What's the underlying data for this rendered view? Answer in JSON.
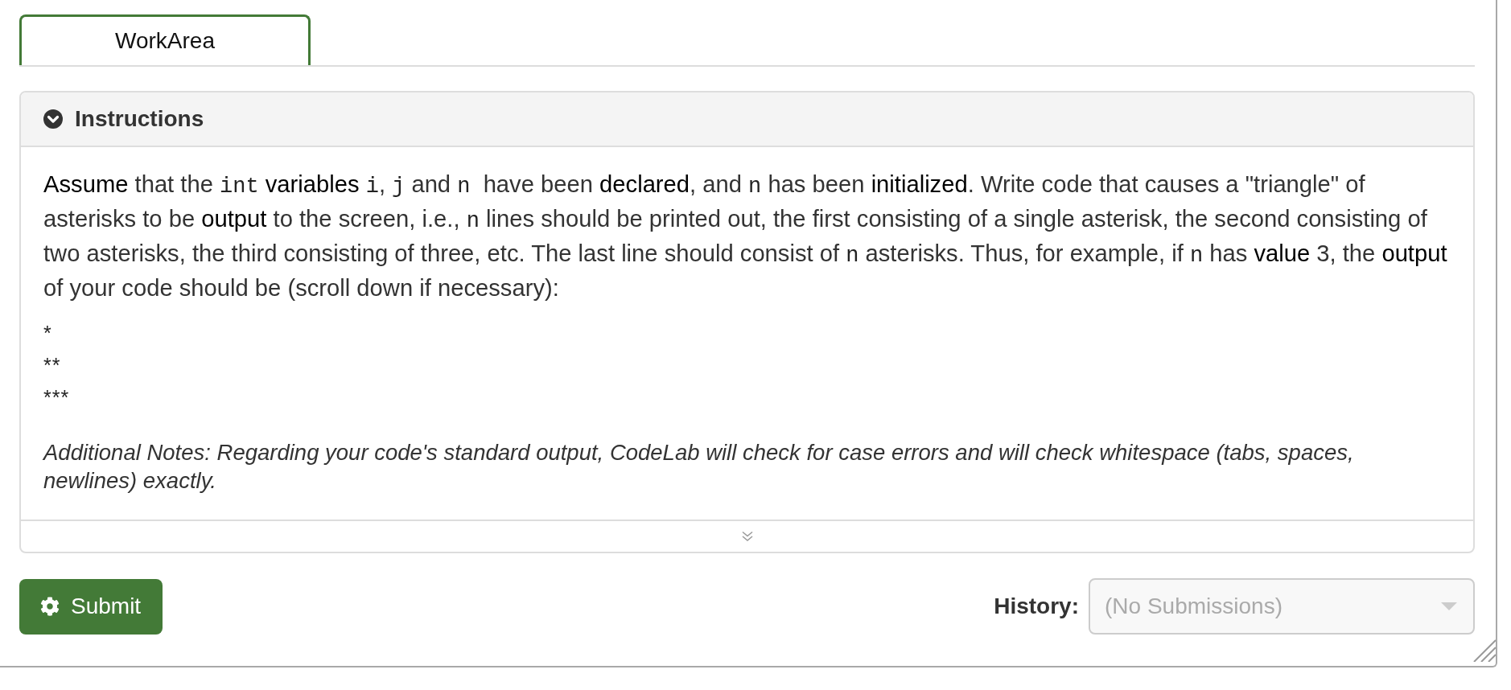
{
  "tabs": [
    {
      "label": "WorkArea",
      "selected": true
    }
  ],
  "instructions": {
    "title": "Instructions",
    "expanded": true,
    "paragraph": [
      {
        "kind": "term",
        "text": "Assume"
      },
      {
        "kind": "text",
        "text": " that the "
      },
      {
        "kind": "code",
        "text": "int"
      },
      {
        "kind": "term",
        "text": " variables "
      },
      {
        "kind": "code",
        "text": "i"
      },
      {
        "kind": "text",
        "text": ", "
      },
      {
        "kind": "code",
        "text": "j"
      },
      {
        "kind": "text",
        "text": " and "
      },
      {
        "kind": "code",
        "text": "n"
      },
      {
        "kind": "text",
        "text": "  have been "
      },
      {
        "kind": "term",
        "text": "declared"
      },
      {
        "kind": "text",
        "text": ", and "
      },
      {
        "kind": "code",
        "text": "n"
      },
      {
        "kind": "text",
        "text": " has been "
      },
      {
        "kind": "term",
        "text": "initialized"
      },
      {
        "kind": "text",
        "text": ". Write code that causes a \"triangle\" of asterisks to be "
      },
      {
        "kind": "term",
        "text": "output"
      },
      {
        "kind": "text",
        "text": " to the screen, i.e., "
      },
      {
        "kind": "code",
        "text": "n"
      },
      {
        "kind": "text",
        "text": " lines should be printed out, the first consisting of a single asterisk, the second consisting of two asterisks, the third consisting of three, etc. The last line should consist of "
      },
      {
        "kind": "code",
        "text": "n"
      },
      {
        "kind": "text",
        "text": " asterisks. Thus, for example, if "
      },
      {
        "kind": "code",
        "text": "n"
      },
      {
        "kind": "text",
        "text": " has "
      },
      {
        "kind": "term",
        "text": "value"
      },
      {
        "kind": "text",
        "text": " 3, the "
      },
      {
        "kind": "term",
        "text": "output"
      },
      {
        "kind": "text",
        "text": " of your code should be (scroll down if necessary):"
      }
    ],
    "example_output": "*\n**\n***",
    "notes": "Additional Notes: Regarding your code's standard output, CodeLab will check for case errors and will check whitespace (tabs, spaces, newlines) exactly."
  },
  "actions": {
    "submit": {
      "label": "Submit"
    },
    "history": {
      "label": "History:",
      "value": "(No Submissions)",
      "disabled": true
    }
  }
}
